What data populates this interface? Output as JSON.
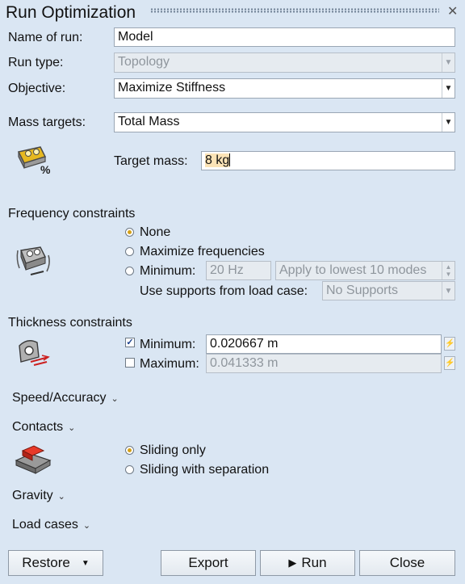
{
  "window": {
    "title": "Run Optimization",
    "close_icon": "close-icon"
  },
  "run_name": {
    "label": "Name of run:",
    "value": "Model"
  },
  "run_type": {
    "label": "Run type:",
    "value": "Topology"
  },
  "objective": {
    "label": "Objective:",
    "value": "Maximize Stiffness"
  },
  "mass_targets": {
    "label": "Mass targets:",
    "value": "Total Mass",
    "icon_text": "%"
  },
  "target_mass": {
    "label": "Target mass:",
    "value": "8 kg"
  },
  "frequency": {
    "title": "Frequency constraints",
    "options": [
      "None",
      "Maximize frequencies",
      "Minimum:"
    ],
    "selected": "None",
    "min_value": "20 Hz",
    "modes_value": "Apply to lowest 10 modes",
    "supports_label": "Use supports from load case:",
    "supports_value": "No Supports"
  },
  "thickness": {
    "title": "Thickness constraints",
    "minimum": {
      "label": "Minimum:",
      "checked": true,
      "value": "0.020667 m"
    },
    "maximum": {
      "label": "Maximum:",
      "checked": false,
      "value": "0.041333 m"
    }
  },
  "speed_accuracy": {
    "label": "Speed/Accuracy"
  },
  "contacts": {
    "label": "Contacts",
    "options": [
      "Sliding only",
      "Sliding with separation"
    ],
    "selected": "Sliding only"
  },
  "gravity": {
    "label": "Gravity"
  },
  "load_cases": {
    "label": "Load cases"
  },
  "buttons": {
    "restore": "Restore",
    "export": "Export",
    "run": "Run",
    "close": "Close"
  },
  "colors": {
    "background": "#dae6f3",
    "radio_selected": "#d4a017",
    "input_highlight": "#fbe3b6"
  }
}
